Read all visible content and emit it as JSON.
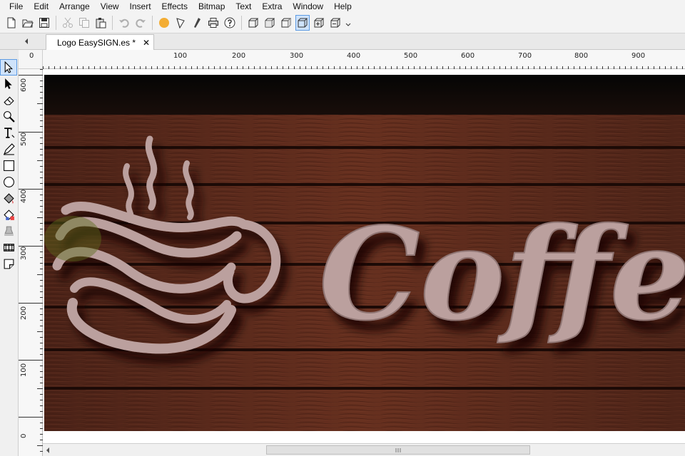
{
  "menu": [
    "File",
    "Edit",
    "Arrange",
    "View",
    "Insert",
    "Effects",
    "Bitmap",
    "Text",
    "Extra",
    "Window",
    "Help"
  ],
  "document_tab": {
    "label": "Logo EasySIGN.es *",
    "close_glyph": "✕"
  },
  "toolbar_icons": [
    "new-document-icon",
    "open-folder-icon",
    "save-icon",
    "cut-icon",
    "copy-icon",
    "paste-icon",
    "undo-icon",
    "redo-icon",
    "color-dot-icon",
    "pen-tool-icon",
    "cutter-icon",
    "print-icon",
    "help-icon",
    "box-front-icon",
    "box-back-icon",
    "box-side-icon",
    "box-active-icon",
    "box-plus-icon",
    "box-minus-icon",
    "more-icon"
  ],
  "tools": [
    "select-arrow-icon",
    "node-edit-icon",
    "eraser-icon",
    "zoom-icon",
    "text-tool-icon",
    "pen-icon",
    "rectangle-icon",
    "ellipse-icon",
    "fill-icon",
    "gradient-fill-icon",
    "stamp-icon",
    "bitmap-icon",
    "page-curl-icon"
  ],
  "ruler": {
    "h_labels": [
      "0",
      "100",
      "200",
      "300",
      "400",
      "500",
      "600",
      "700",
      "800",
      "900"
    ],
    "v_labels": [
      "600",
      "500",
      "400",
      "300",
      "200",
      "100",
      "0"
    ]
  },
  "artwork": {
    "text": "Coffee",
    "board_color": "#5a2a1c",
    "letter_color": "#bba09e"
  }
}
